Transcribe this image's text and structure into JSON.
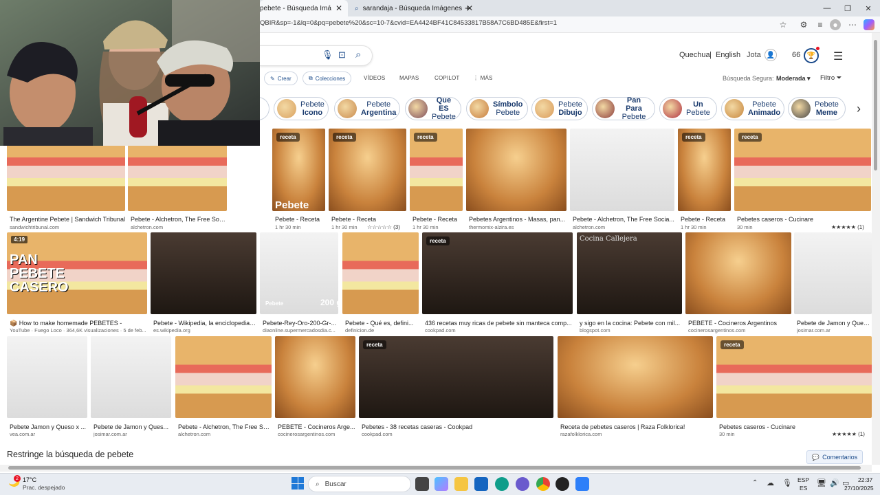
{
  "browser": {
    "tabs": [
      {
        "title": "pebete - Búsqueda Imágenes"
      },
      {
        "title": "sarandaja - Búsqueda Imágenes"
      }
    ],
    "new_tab_icon": "plus-icon",
    "url": "QBIR&sp=-1&lq=0&pq=pebete%20&sc=10-7&cvid=EA4424BF41C84533817B58A7C6BD485E&first=1"
  },
  "header": {
    "lang1": "Quechua",
    "sep": "|",
    "lang2": "English",
    "user": "Jota",
    "rewards": "66"
  },
  "nav": {
    "crear": "Crear",
    "colecciones": "Colecciones",
    "videos": "VÍDEOS",
    "mapas": "MAPAS",
    "copilot": "COPILOT",
    "mas": "MÁS",
    "safe_label": "Búsqueda Segura:",
    "safe_value": "Moderada",
    "filtro": "Filtro"
  },
  "chips": [
    {
      "top": "Pebete",
      "bottom": "Icono",
      "bold": "bottom"
    },
    {
      "top": "Pebete",
      "bottom": "Argentina",
      "bold": "bottom"
    },
    {
      "top": "Que ES",
      "bottom": "Pebete",
      "bold": "top"
    },
    {
      "top": "Símbolo",
      "bottom": "Pebete",
      "bold": "top"
    },
    {
      "top": "Pebete",
      "bottom": "Dibujo",
      "bold": "bottom"
    },
    {
      "top": "Pan Para",
      "bottom": "Pebete",
      "bold": "top"
    },
    {
      "top": "Un",
      "bottom": "Pebete",
      "bold": "top"
    },
    {
      "top": "Pebete",
      "bottom": "Animado",
      "bold": "bottom"
    },
    {
      "top": "Pebete",
      "bottom": "Meme",
      "bold": "bottom"
    }
  ],
  "badges": {
    "receta": "receta",
    "duration": "4:19"
  },
  "overlays": {
    "pan_pebete": "PAN PEBETE CASERO",
    "pebete_bag": "Pebete",
    "pebete_200": "Pebete",
    "grams": "200 g",
    "cocina": "Cocina Callejera"
  },
  "row1": [
    {
      "caption": "The Argentine Pebete | Sandwich Tribunal",
      "source": "sandwichtribunal.com"
    },
    {
      "caption": "Pebete - Alchetron, The Free Social Encyclopedia",
      "source": "alchetron.com"
    },
    {
      "caption": "Pebete - Receta",
      "source": "1 hr 30 min"
    },
    {
      "caption": "Pebete - Receta",
      "source": "1 hr 30 min",
      "rating": "☆☆☆☆☆ (3)"
    },
    {
      "caption": "Pebete - Receta",
      "source": "1 hr 30 min"
    },
    {
      "caption": "Pebetes Argentinos - Masas, pan...",
      "source": "thermomix-alzira.es"
    },
    {
      "caption": "Pebete - Alchetron, The Free Socia...",
      "source": "alchetron.com"
    },
    {
      "caption": "Pebete - Receta",
      "source": "1 hr 30 min"
    },
    {
      "caption": "Pebetes caseros - Cucinare",
      "source": "30 min",
      "rating": "★★★★★ (1)"
    }
  ],
  "row2": [
    {
      "caption": "📦 How to make homemade PEBETES -",
      "source": "YouTube · Fuego Loco · 364,6K visualizaciones · 5 de feb..."
    },
    {
      "caption": "Pebete - Wikipedia, la enciclopedia ...",
      "source": "es.wikipedia.org"
    },
    {
      "caption": "Pebete-Rey-Oro-200-Gr-...",
      "source": "diaonline.supermercadosdia.c..."
    },
    {
      "caption": "Pebete - Qué es, defini...",
      "source": "definicion.de"
    },
    {
      "caption": "436 recetas muy ricas de pebete sin manteca comp...",
      "source": "cookpad.com"
    },
    {
      "caption": "y sigo en la cocina: Pebete con mil...",
      "source": "blogspot.com"
    },
    {
      "caption": "PEBETE - Cocineros Argentinos",
      "source": "cocinerosargentinos.com"
    },
    {
      "caption": "Pebete de Jamon y Ques...",
      "source": "josimar.com.ar"
    }
  ],
  "row3": [
    {
      "caption": "Pebete Jamon y Queso x ...",
      "source": "vea.com.ar"
    },
    {
      "caption": "Pebete de Jamon y Ques...",
      "source": "josimar.com.ar"
    },
    {
      "caption": "Pebete - Alchetron, The Free So...",
      "source": "alchetron.com"
    },
    {
      "caption": "PEBETE - Cocineros Arge...",
      "source": "cocinerosargentinos.com"
    },
    {
      "caption": "Pebetes - 38 recetas caseras - Cookpad",
      "source": "cookpad.com"
    },
    {
      "caption": "Receta de pebetes caseros | Raza Folklorica!",
      "source": "razafolklorica.com"
    },
    {
      "caption": "Pebetes caseros - Cucinare",
      "source": "30 min",
      "rating": "★★★★★ (1)"
    }
  ],
  "footer": {
    "restrict": "Restringe la búsqueda de pebete",
    "comentarios": "Comentarios"
  },
  "taskbar": {
    "weather_temp": "17°C",
    "weather_desc": "Prac. despejado",
    "weather_badge": "2",
    "search": "Buscar",
    "lang": "ESP",
    "lang2": "ES",
    "time": "22:37",
    "date": "27/10/2025"
  },
  "colors": {
    "accent": "#1a4a8a",
    "bing_blue": "#174ae4",
    "red_badge": "#e81123"
  }
}
